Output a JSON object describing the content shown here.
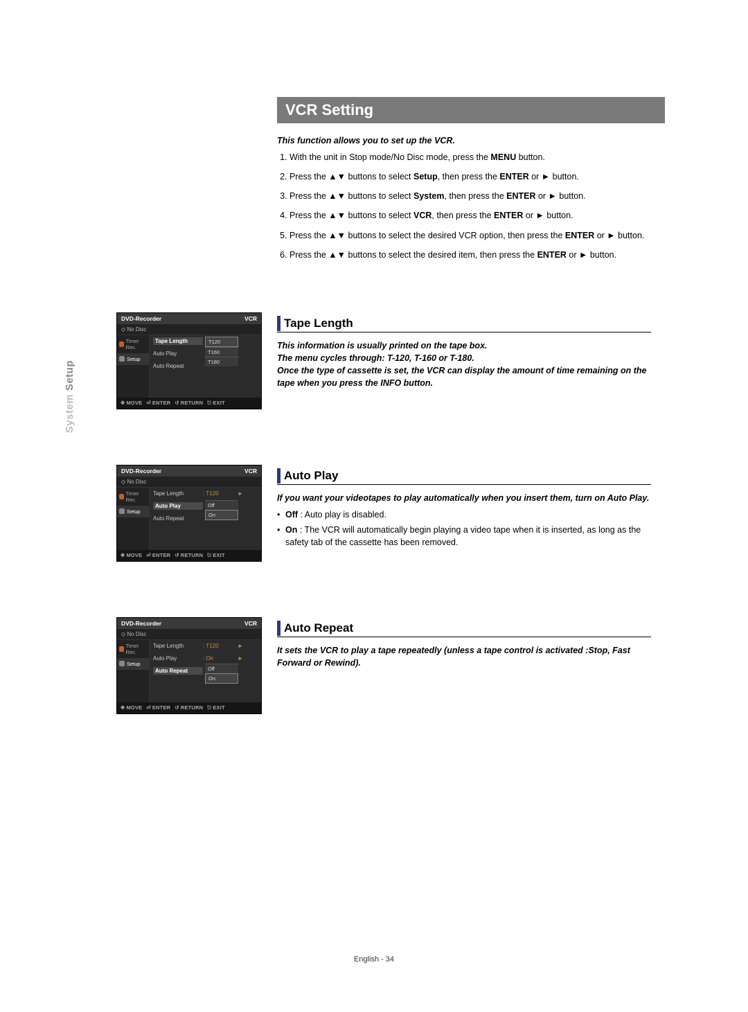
{
  "side_tab": {
    "light": "System",
    "strong": " Setup"
  },
  "title": "VCR Setting",
  "intro": "This function allows you to set up the VCR.",
  "steps": [
    {
      "pre": "With the unit in Stop mode/No Disc mode, press the ",
      "b1": "MENU",
      "post1": " button."
    },
    {
      "pre": "Press the ▲▼ buttons to select ",
      "b1": "Setup",
      "mid": ", then press the ",
      "b2": "ENTER",
      "post1": " or ► button."
    },
    {
      "pre": "Press the ▲▼ buttons to select ",
      "b1": "System",
      "mid": ", then press the ",
      "b2": "ENTER",
      "post1": " or ► button."
    },
    {
      "pre": "Press the ▲▼ buttons to select ",
      "b1": "VCR",
      "mid": ", then press the ",
      "b2": "ENTER",
      "post1": " or ► button."
    },
    {
      "pre": "Press the ▲▼ buttons to select the desired VCR option, then press the ",
      "b1": "ENTER",
      "post1": " or ► button."
    },
    {
      "pre": "Press the ▲▼ buttons to select the desired item, then press the ",
      "b1": "ENTER",
      "post1": " or ► button."
    }
  ],
  "sections": {
    "tape": {
      "heading": "Tape Length",
      "desc": "This information is usually printed on the tape box.\nThe menu cycles through: T-120, T-160 or T-180.\nOnce the type of cassette is set, the VCR can display the amount of time remaining on the tape when you press the INFO button."
    },
    "autoplay": {
      "heading": "Auto Play",
      "desc": "If you want your videotapes to play automatically when you insert them, turn on Auto Play.",
      "bullets": [
        {
          "b": "Off",
          "t": " : Auto play is disabled."
        },
        {
          "b": "On",
          "t": " : The VCR will automatically begin playing a video tape when it is inserted, as long as the safety tab of the cassette has been removed."
        }
      ]
    },
    "autorepeat": {
      "heading": "Auto Repeat",
      "desc": "It sets the VCR to play a tape repeatedly (unless a tape control is activated :Stop, Fast Forward or Rewind)."
    }
  },
  "osd": {
    "title": "DVD-Recorder",
    "corner": "VCR",
    "nodisc": "No Disc",
    "leftItems": [
      "Timer Rec.",
      "Setup"
    ],
    "rows": {
      "tapeLength": "Tape Length",
      "autoPlay": "Auto Play",
      "autoRepeat": "Auto Repeat"
    },
    "footer": {
      "move": "MOVE",
      "enter": "ENTER",
      "return": "RETURN",
      "exit": "EXIT"
    },
    "screen1": {
      "rows": [
        {
          "lbl": "Tape Length",
          "hilite": true
        },
        {
          "lbl": "Auto Play"
        },
        {
          "lbl": "Auto Repeat"
        }
      ],
      "opts": [
        "T120",
        "T160",
        "T180"
      ],
      "selectedOpt": 0
    },
    "screen2": {
      "rows": [
        {
          "lbl": "Tape Length",
          "val": ": T120",
          "arrow": "►"
        },
        {
          "lbl": "Auto Play",
          "hilite": true
        },
        {
          "lbl": "Auto Repeat"
        }
      ],
      "opts": [
        "Off",
        "On"
      ],
      "optsTop": 18,
      "selectedOpt": 1
    },
    "screen3": {
      "rows": [
        {
          "lbl": "Tape Length",
          "val": ": T120",
          "arrow": "►"
        },
        {
          "lbl": "Auto Play",
          "val": ": On",
          "arrow": "►"
        },
        {
          "lbl": "Auto Repeat",
          "hilite": true
        }
      ],
      "opts": [
        "Off",
        "On"
      ],
      "optsTop": 34,
      "selectedOpt": 1
    }
  },
  "footer": "English - 34"
}
